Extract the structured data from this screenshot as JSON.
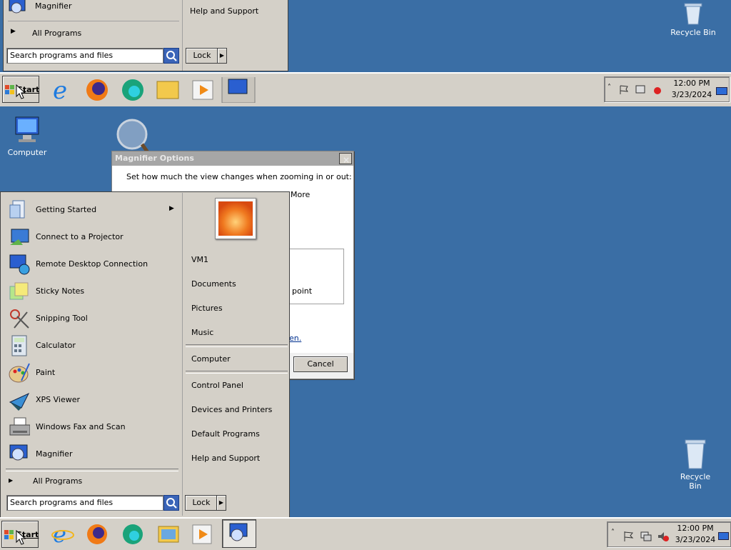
{
  "desktop": {
    "icons": [
      {
        "label": "Computer"
      },
      {
        "label": "Recycle Bin"
      }
    ]
  },
  "dialog": {
    "title": "Magnifier Options",
    "instruction": "Set how much the view changes when zooming in or out:",
    "more_label": "More",
    "point_text": "point",
    "link_fragment": "en.",
    "cancel_label": "Cancel",
    "close_glyph": "×"
  },
  "start_menu": {
    "programs": [
      {
        "label": "Getting Started",
        "icon": "getting-started-icon",
        "has_submenu": true
      },
      {
        "label": "Connect to a Projector",
        "icon": "projector-icon"
      },
      {
        "label": "Remote Desktop Connection",
        "icon": "remote-desktop-icon"
      },
      {
        "label": "Sticky Notes",
        "icon": "sticky-notes-icon"
      },
      {
        "label": "Snipping Tool",
        "icon": "scissors-icon"
      },
      {
        "label": "Calculator",
        "icon": "calculator-icon"
      },
      {
        "label": "Paint",
        "icon": "paint-palette-icon"
      },
      {
        "label": "XPS Viewer",
        "icon": "xps-viewer-icon"
      },
      {
        "label": "Windows Fax and Scan",
        "icon": "fax-icon"
      },
      {
        "label": "Magnifier",
        "icon": "magnifier-icon"
      }
    ],
    "all_programs": "All Programs",
    "search_placeholder": "Search programs and files",
    "lock_label": "Lock",
    "right_items": [
      "VM1",
      "Documents",
      "Pictures",
      "Music",
      "Computer",
      "Control Panel",
      "Devices and Printers",
      "Default Programs",
      "Help and Support"
    ]
  },
  "taskbar": {
    "start_label": "Start",
    "pinned": [
      {
        "icon": "internet-explorer-icon"
      },
      {
        "icon": "firefox-icon"
      },
      {
        "icon": "edge-icon"
      },
      {
        "icon": "file-explorer-icon"
      },
      {
        "icon": "media-player-icon"
      },
      {
        "icon": "magnifier-app-icon"
      }
    ],
    "clock_time": "12:00 PM",
    "clock_date": "3/23/2024"
  },
  "zoom_view": {
    "magnifier_label": "Magnifier",
    "all_programs": "All Programs",
    "help_support": "Help and Support",
    "search_placeholder": "Search programs and files",
    "lock_label": "Lock",
    "start_label": "Start",
    "clock_time": "12:00 PM",
    "clock_date": "3/23/2024",
    "recycle_bin": "Recycle Bin"
  },
  "colors": {
    "desktop": "#3a6ea5",
    "chrome": "#d4d0c8"
  }
}
